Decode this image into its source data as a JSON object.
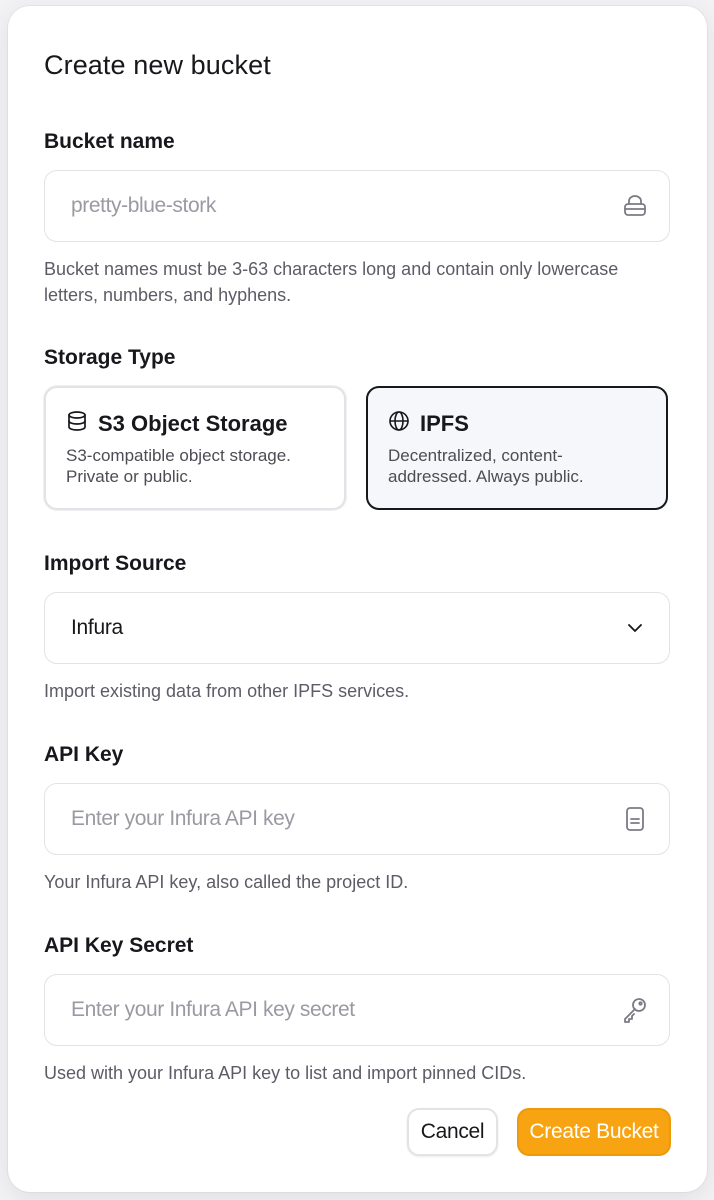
{
  "dialog": {
    "title": "Create new bucket"
  },
  "bucket_name": {
    "label": "Bucket name",
    "placeholder": "pretty-blue-stork",
    "icon": "lock-icon",
    "help": "Bucket names must be 3-63 characters long and contain only lowercase letters, numbers, and hyphens."
  },
  "storage_type": {
    "label": "Storage Type",
    "options": [
      {
        "title": "S3 Object Storage",
        "description": "S3-compatible object storage. Private or public.",
        "icon": "database-icon",
        "selected": false
      },
      {
        "title": "IPFS",
        "description": "Decentralized, content-addressed. Always public.",
        "icon": "globe-icon",
        "selected": true
      }
    ]
  },
  "import_source": {
    "label": "Import Source",
    "value": "Infura",
    "icon": "chevron-down-icon",
    "help": "Import existing data from other IPFS services."
  },
  "api_key": {
    "label": "API Key",
    "placeholder": "Enter your Infura API key",
    "icon": "document-icon",
    "help": "Your Infura API key, also called the project ID."
  },
  "api_key_secret": {
    "label": "API Key Secret",
    "placeholder": "Enter your Infura API key secret",
    "icon": "key-icon",
    "help": "Used with your Infura API key to list and import pinned CIDs."
  },
  "actions": {
    "cancel_label": "Cancel",
    "create_label": "Create Bucket"
  },
  "colors": {
    "accent": "#f8a312",
    "selected_border": "#17171c"
  }
}
